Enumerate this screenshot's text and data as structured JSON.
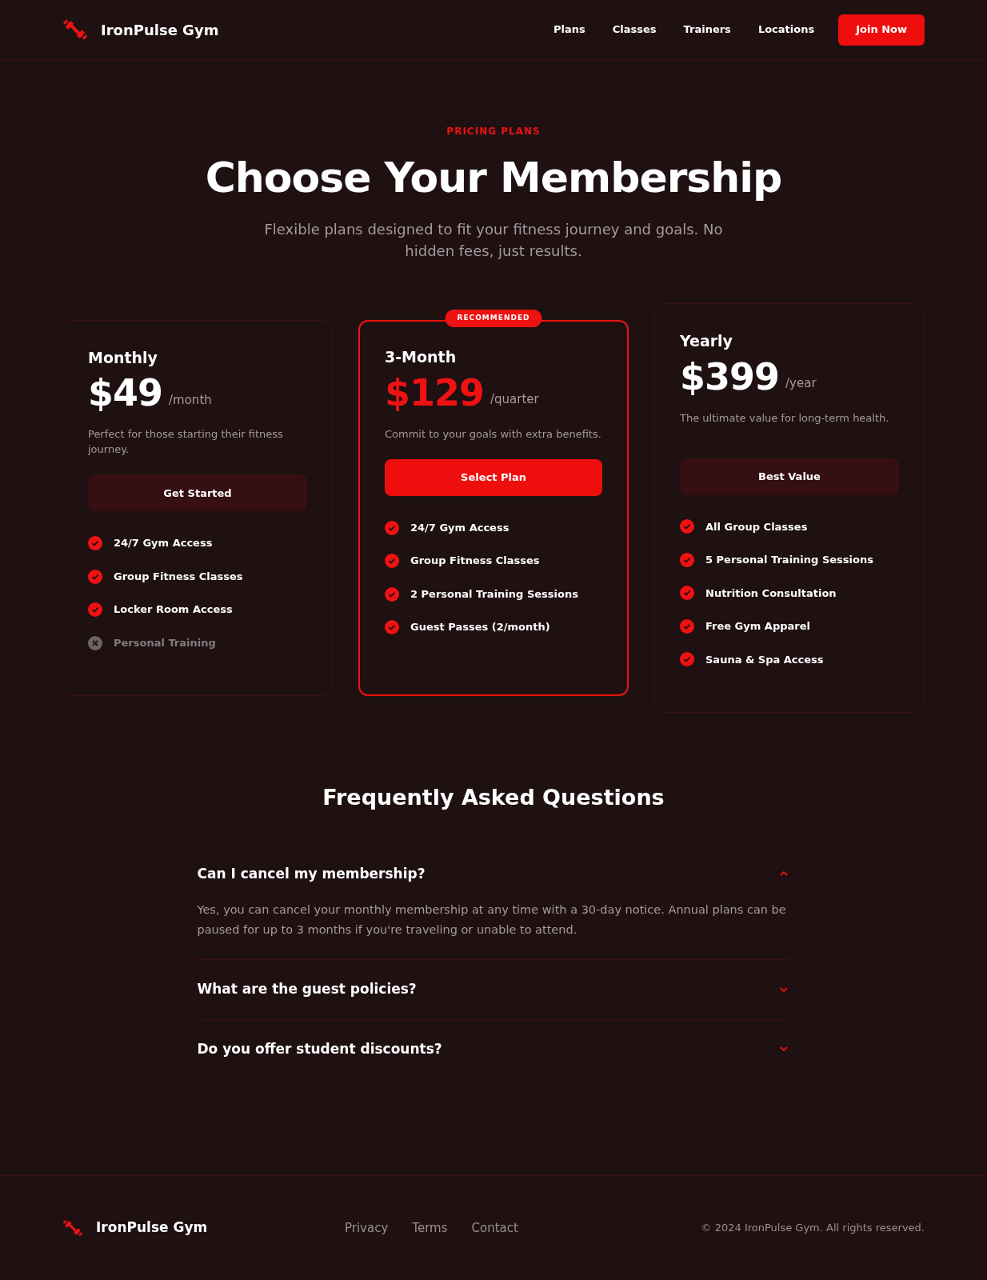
{
  "header": {
    "brand": "IronPulse Gym",
    "nav": [
      {
        "label": "Plans"
      },
      {
        "label": "Classes"
      },
      {
        "label": "Trainers"
      },
      {
        "label": "Locations"
      }
    ],
    "cta": "Join Now"
  },
  "hero": {
    "eyebrow": "PRICING PLANS",
    "title": "Choose Your Membership",
    "subtitle": "Flexible plans designed to fit your fitness journey and goals. No hidden fees, just results."
  },
  "plans": [
    {
      "name": "Monthly",
      "price": "$49",
      "period": "/month",
      "description": "Perfect for those starting their fitness journey.",
      "button": "Get Started",
      "featured": false,
      "features": [
        {
          "label": "24/7 Gym Access",
          "included": true
        },
        {
          "label": "Group Fitness Classes",
          "included": true
        },
        {
          "label": "Locker Room Access",
          "included": true
        },
        {
          "label": "Personal Training",
          "included": false
        }
      ]
    },
    {
      "name": "3-Month",
      "badge": "RECOMMENDED",
      "price": "$129",
      "period": "/quarter",
      "description": "Commit to your goals with extra benefits.",
      "button": "Select Plan",
      "featured": true,
      "features": [
        {
          "label": "24/7 Gym Access",
          "included": true
        },
        {
          "label": "Group Fitness Classes",
          "included": true
        },
        {
          "label": "2 Personal Training Sessions",
          "included": true
        },
        {
          "label": "Guest Passes (2/month)",
          "included": true
        }
      ]
    },
    {
      "name": "Yearly",
      "price": "$399",
      "period": "/year",
      "description": "The ultimate value for long-term health.",
      "button": "Best Value",
      "featured": false,
      "features": [
        {
          "label": "All Group Classes",
          "included": true
        },
        {
          "label": "5 Personal Training Sessions",
          "included": true
        },
        {
          "label": "Nutrition Consultation",
          "included": true
        },
        {
          "label": "Free Gym Apparel",
          "included": true
        },
        {
          "label": "Sauna & Spa Access",
          "included": true
        }
      ]
    }
  ],
  "faq": {
    "title": "Frequently Asked Questions",
    "items": [
      {
        "question": "Can I cancel my membership?",
        "answer": "Yes, you can cancel your monthly membership at any time with a 30-day notice. Annual plans can be paused for up to 3 months if you're traveling or unable to attend.",
        "expanded": true
      },
      {
        "question": "What are the guest policies?",
        "expanded": false
      },
      {
        "question": "Do you offer student discounts?",
        "expanded": false
      }
    ]
  },
  "footer": {
    "brand": "IronPulse Gym",
    "links": [
      {
        "label": "Privacy"
      },
      {
        "label": "Terms"
      },
      {
        "label": "Contact"
      }
    ],
    "copyright": "© 2024 IronPulse Gym. All rights reserved."
  }
}
